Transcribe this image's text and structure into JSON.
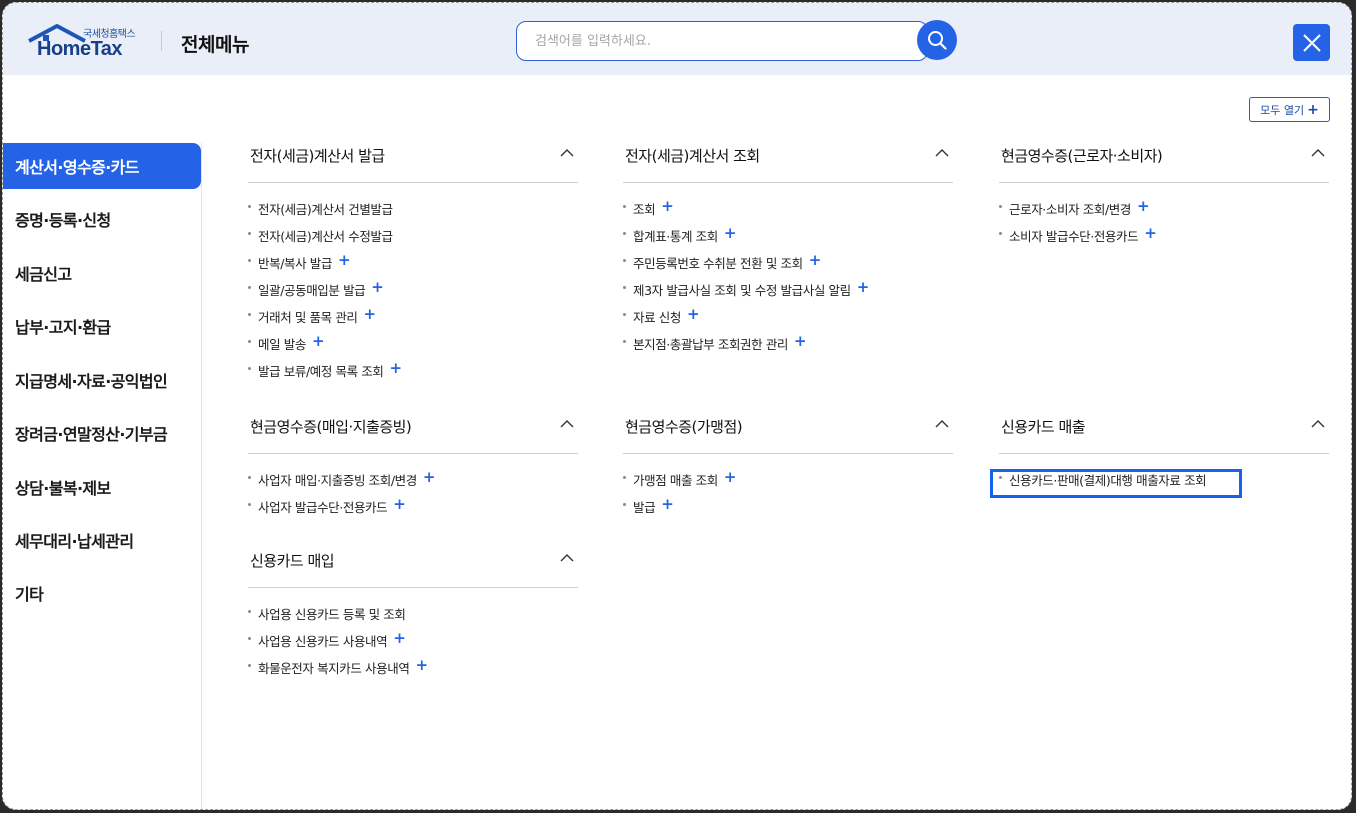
{
  "header": {
    "logo_sub": "국세청홈택스",
    "logo_main": "HomeTax",
    "title": "전체메뉴",
    "search_placeholder": "검색어를 입력하세요."
  },
  "open_all_label": "모두 열기",
  "sidebar": {
    "items": [
      {
        "label": "계산서·영수증·카드",
        "active": true
      },
      {
        "label": "증명·등록·신청"
      },
      {
        "label": "세금신고"
      },
      {
        "label": "납부·고지·환급"
      },
      {
        "label": "지급명세·자료·공익법인"
      },
      {
        "label": "장려금·연말정산·기부금"
      },
      {
        "label": "상담·불복·제보"
      },
      {
        "label": "세무대리·납세관리"
      },
      {
        "label": "기타"
      }
    ]
  },
  "sections": [
    {
      "title": "전자(세금)계산서 발급",
      "items": [
        {
          "label": "전자(세금)계산서 건별발급",
          "plus": false
        },
        {
          "label": "전자(세금)계산서 수정발급",
          "plus": false
        },
        {
          "label": "반복/복사 발급",
          "plus": true
        },
        {
          "label": "일괄/공동매입분 발급",
          "plus": true
        },
        {
          "label": "거래처 및 품목 관리",
          "plus": true
        },
        {
          "label": "메일 발송",
          "plus": true
        },
        {
          "label": "발급 보류/예정 목록 조회",
          "plus": true
        }
      ]
    },
    {
      "title": "전자(세금)계산서 조회",
      "items": [
        {
          "label": "조회",
          "plus": true
        },
        {
          "label": "합계표·통계 조회",
          "plus": true
        },
        {
          "label": "주민등록번호 수취분 전환 및 조회",
          "plus": true
        },
        {
          "label": "제3자 발급사실 조회 및 수정 발급사실 알림",
          "plus": true
        },
        {
          "label": "자료 신청",
          "plus": true
        },
        {
          "label": "본지점·총괄납부 조회권한 관리",
          "plus": true
        }
      ]
    },
    {
      "title": "현금영수증(근로자·소비자)",
      "items": [
        {
          "label": "근로자·소비자 조회/변경",
          "plus": true
        },
        {
          "label": "소비자 발급수단·전용카드",
          "plus": true
        }
      ]
    },
    {
      "title": "현금영수증(매입·지출증빙)",
      "items": [
        {
          "label": "사업자 매입·지출증빙 조회/변경",
          "plus": true
        },
        {
          "label": "사업자 발급수단·전용카드",
          "plus": true
        }
      ]
    },
    {
      "title": "현금영수증(가맹점)",
      "items": [
        {
          "label": "가맹점 매출 조회",
          "plus": true
        },
        {
          "label": "발급",
          "plus": true
        }
      ]
    },
    {
      "title": "신용카드 매출",
      "items": [
        {
          "label": "신용카드·판매(결제)대행 매출자료 조회",
          "plus": false
        }
      ]
    },
    {
      "title": "신용카드 매입",
      "items": [
        {
          "label": "사업용 신용카드 등록 및 조회",
          "plus": false
        },
        {
          "label": "사업용 신용카드 사용내역",
          "plus": true
        },
        {
          "label": "화물운전자 복지카드 사용내역",
          "plus": true
        }
      ]
    }
  ]
}
